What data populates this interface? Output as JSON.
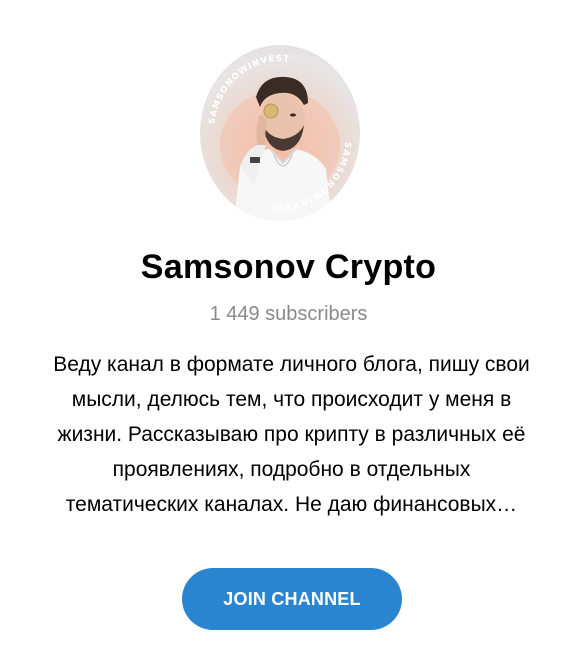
{
  "channel": {
    "avatar_ring_text": "SAMSONOWINVEST",
    "title": "Samsonov Crypto",
    "subscribers": "1 449 subscribers",
    "description_lines": [
      "Веду канал в формате личного блога, пишу свои",
      "мысли, делюсь тем, что происходит у меня в",
      "жизни. Рассказываю про крипту в различных её",
      "проявлениях, подробно в отдельных",
      "тематических каналах. Не даю финансовых…"
    ]
  },
  "actions": {
    "join_label": "JOIN CHANNEL"
  },
  "colors": {
    "accent": "#2a85d0",
    "muted_text": "#8a8a8e",
    "avatar_glow": "#f3b7a0"
  }
}
